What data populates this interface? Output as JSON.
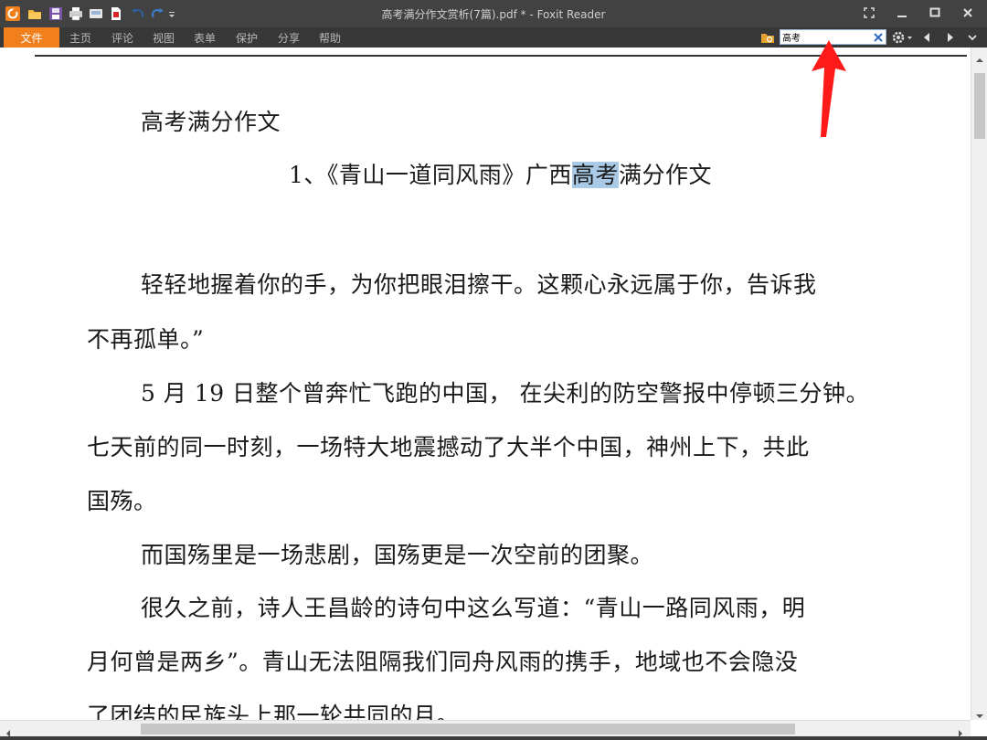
{
  "window": {
    "title": "高考满分作文赏析(7篇).pdf * - Foxit Reader",
    "accent_color": "#f07f1c"
  },
  "quick_access": {
    "icons": [
      "foxit-logo-icon",
      "open-folder-icon",
      "save-icon",
      "print-icon",
      "scan-icon",
      "pdf-create-icon",
      "undo-icon",
      "redo-icon",
      "customize-icon"
    ]
  },
  "menu": {
    "file": "文件",
    "items": [
      "主页",
      "评论",
      "视图",
      "表单",
      "保护",
      "分享",
      "帮助"
    ]
  },
  "search": {
    "value": "高考",
    "icons": [
      "find-folder-icon",
      "clear-icon",
      "gear-icon",
      "prev-icon",
      "next-icon",
      "expand-icon"
    ]
  },
  "document": {
    "heading": "高考满分作文",
    "title_before": "1、《青山一道同风雨》广西",
    "title_highlight": "高考",
    "title_after": "满分作文",
    "lines": [
      "轻轻地握着你的手，为你把眼泪擦干。这颗心永远属于你，告诉我",
      "不再孤单。”",
      "5 月 19 日整个曾奔忙飞跑的中国， 在尖利的防空警报中停顿三分钟。",
      "七天前的同一时刻，一场特大地震撼动了大半个中国，神州上下，共此",
      "国殇。",
      "而国殇里是一场悲剧，国殇更是一次空前的团聚。",
      "很久之前，诗人王昌龄的诗句中这么写道：“青山一路同风雨，明",
      "月何曾是两乡”。青山无法阻隔我们同舟风雨的携手，地域也不会隐没",
      "了团结的民族头上那一轮共同的月。"
    ]
  },
  "annotation": {
    "arrow_color": "#ff1a1a"
  }
}
